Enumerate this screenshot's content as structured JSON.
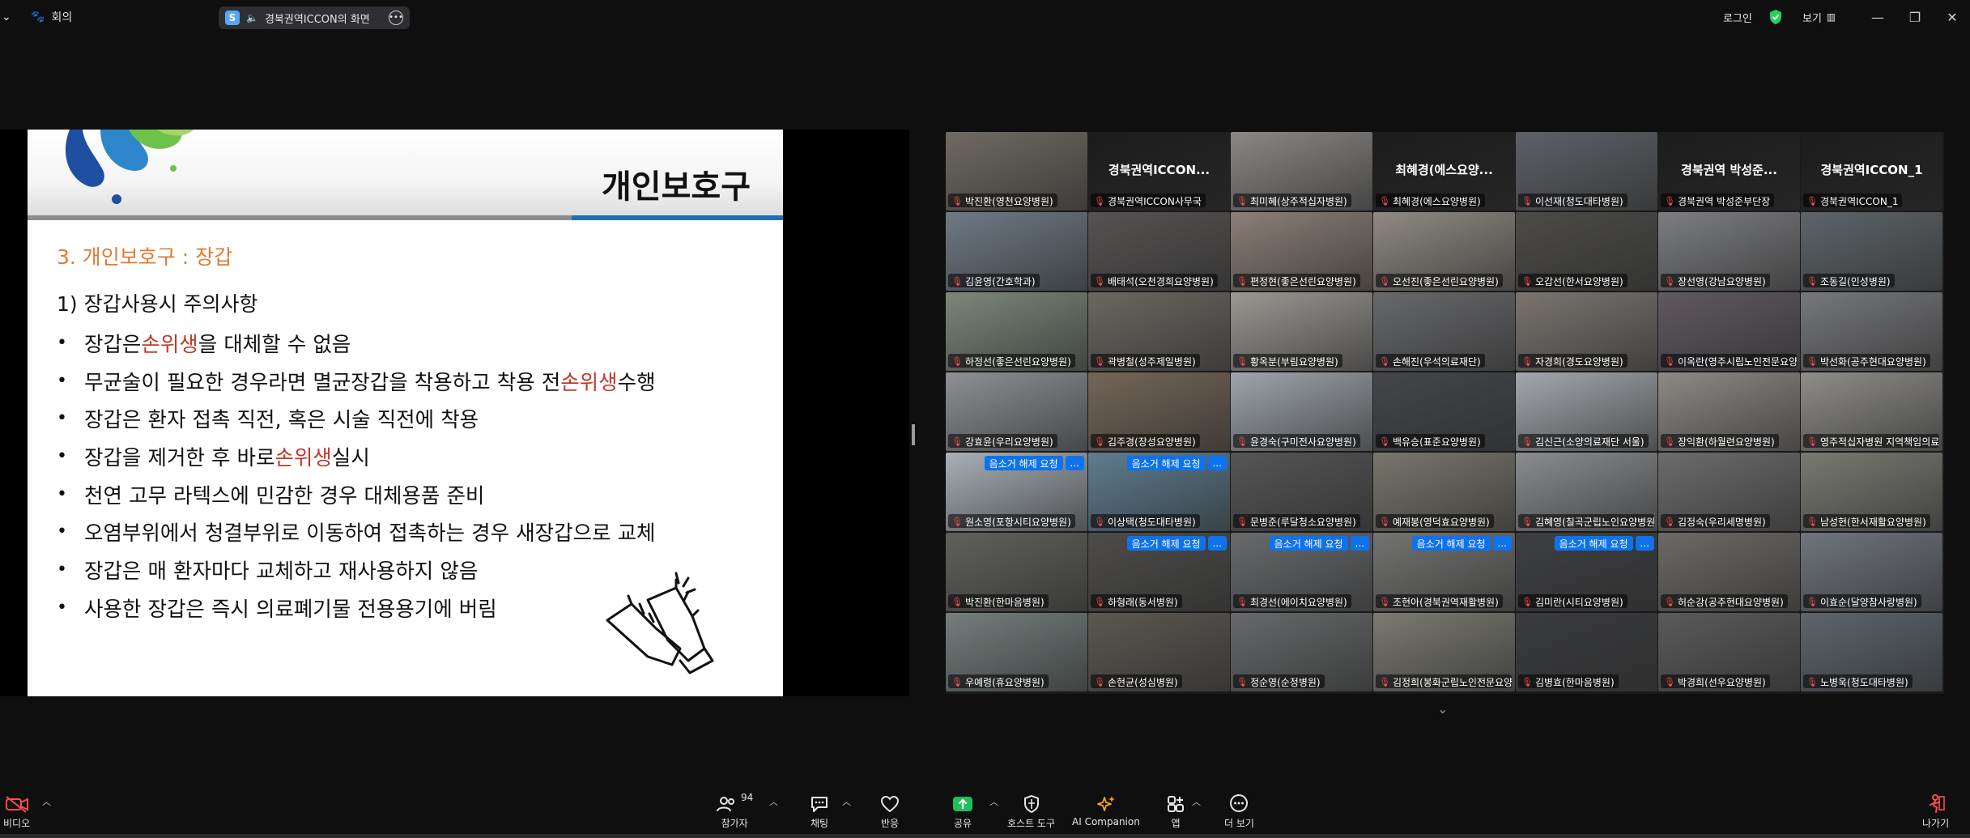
{
  "topbar": {
    "menu_label": "회의",
    "share_label": "경북권역ICCON의 화면",
    "login_label": "로그인",
    "view_label": "보기"
  },
  "slide": {
    "title": "개인보호구",
    "section": "3.   개인보호구 : 장갑",
    "subtitle": "1)   장갑사용시 주의사항",
    "bullets": [
      {
        "pre": "장갑은 ",
        "hl": "손위생",
        "post": "을 대체할 수 없음"
      },
      {
        "pre": "무균술이 필요한 경우라면 멸균장갑을 착용하고 착용 전 ",
        "hl": "손위생",
        "post": " 수행"
      },
      {
        "pre": "장갑은 환자 접촉 직전, 혹은 시술 직전에 착용",
        "hl": "",
        "post": ""
      },
      {
        "pre": "장갑을 제거한 후 바로 ",
        "hl": "손위생",
        "post": " 실시"
      },
      {
        "pre": "천연 고무 라텍스에 민감한 경우 대체용품 준비",
        "hl": "",
        "post": ""
      },
      {
        "pre": "오염부위에서 청결부위로 이동하여 접촉하는 경우 새장갑으로 교체",
        "hl": "",
        "post": ""
      },
      {
        "pre": "장갑은 매 환자마다 교체하고 재사용하지 않음",
        "hl": "",
        "post": ""
      },
      {
        "pre": "사용한 장갑은 즉시 의료폐기물 전용용기에 버림",
        "hl": "",
        "post": ""
      }
    ]
  },
  "gallery": {
    "unmute_request": "음소거 해제 요청",
    "more": "...",
    "tiles": [
      {
        "name": "박진환(영천요양병원)",
        "big": "",
        "bg": "#6f6a63",
        "req": false
      },
      {
        "name": "경북권역ICCON사무국",
        "big": "경북권역ICCON...",
        "bg": "#1c1c1c",
        "req": false
      },
      {
        "name": "최미혜(상주적십자병원)",
        "big": "",
        "bg": "#8a8886",
        "req": false
      },
      {
        "name": "최혜경(에스요양병원)",
        "big": "최혜경(에스요양...",
        "bg": "#1c1c1c",
        "req": false
      },
      {
        "name": "이선재(청도대타병원)",
        "big": "",
        "bg": "#5d6166",
        "req": false
      },
      {
        "name": "경북권역 박성준부단장",
        "big": "경북권역 박성준...",
        "bg": "#1c1c1c",
        "req": false
      },
      {
        "name": "경북권역ICCON_1",
        "big": "경북권역ICCON_1",
        "bg": "#1c1c1c",
        "req": false
      },
      {
        "name": "김윤영(간호학과)",
        "big": "",
        "bg": "#6f7a86",
        "req": false
      },
      {
        "name": "배태석(오천경희요양병원)",
        "big": "",
        "bg": "#555352",
        "req": false
      },
      {
        "name": "편정현(좋은선린요양병원)",
        "big": "",
        "bg": "#8c7f77",
        "req": false
      },
      {
        "name": "오선진(좋은선린요양병원)",
        "big": "",
        "bg": "#8f8a84",
        "req": false
      },
      {
        "name": "오갑선(한서요양병원)",
        "big": "",
        "bg": "#4c4b48",
        "req": false
      },
      {
        "name": "장선영(강남요양병원)",
        "big": "",
        "bg": "#7d7e80",
        "req": false
      },
      {
        "name": "조동길(인성병원)",
        "big": "",
        "bg": "#5e6468",
        "req": false
      },
      {
        "name": "하정선(좋은선린요양병원)",
        "big": "",
        "bg": "#7c877b",
        "req": false
      },
      {
        "name": "곽병철(성주제일병원)",
        "big": "",
        "bg": "#6b6762",
        "req": false
      },
      {
        "name": "황옥분(부림요양병원)",
        "big": "",
        "bg": "#9a9893",
        "req": false
      },
      {
        "name": "손해진(우석의료재단)",
        "big": "",
        "bg": "#68696b",
        "req": false
      },
      {
        "name": "자경희(경도요양병원)",
        "big": "",
        "bg": "#7a7571",
        "req": false
      },
      {
        "name": "이옥란(영주시립노인전문요양병원)",
        "big": "",
        "bg": "#5f5960",
        "req": false
      },
      {
        "name": "박선화(공주현대요양병원)",
        "big": "",
        "bg": "#77787a",
        "req": false
      },
      {
        "name": "강효윤(우리요양병원)",
        "big": "",
        "bg": "#8e9094",
        "req": false
      },
      {
        "name": "김주경(장성요양병원)",
        "big": "",
        "bg": "#746658",
        "req": false
      },
      {
        "name": "윤경숙(구미전사요양병원)",
        "big": "",
        "bg": "#9fa5ab",
        "req": false
      },
      {
        "name": "백유승(표준요양병원)",
        "big": "",
        "bg": "#44464a",
        "req": false
      },
      {
        "name": "김신근(소양의료재단 서울)",
        "big": "",
        "bg": "#a4a8ad",
        "req": false
      },
      {
        "name": "장익환(하월련요양병원)",
        "big": "",
        "bg": "#8d8a86",
        "req": false
      },
      {
        "name": "영주적십자병원 지역책임의료",
        "big": "",
        "bg": "#8e8d89",
        "req": false
      },
      {
        "name": "원소영(포항시티요양병원)",
        "big": "",
        "bg": "#a9b0b6",
        "req": true
      },
      {
        "name": "이상택(청도대타병원)",
        "big": "",
        "bg": "#5f7d8f",
        "req": true
      },
      {
        "name": "문병준(루달청소요양병원)",
        "big": "",
        "bg": "#555555",
        "req": false
      },
      {
        "name": "예재봉(영덕효요양병원)",
        "big": "",
        "bg": "#79766c",
        "req": false
      },
      {
        "name": "김혜영(칠곡군립노인요양병원)",
        "big": "",
        "bg": "#8a8c8f",
        "req": false
      },
      {
        "name": "김정숙(우리세명병원)",
        "big": "",
        "bg": "#6c6c6c",
        "req": false
      },
      {
        "name": "남성현(한서재활요양병원)",
        "big": "",
        "bg": "#7a7a74",
        "req": false
      },
      {
        "name": "박진환(한마음병원)",
        "big": "",
        "bg": "#60605c",
        "req": false
      },
      {
        "name": "하형래(동서병원)",
        "big": "",
        "bg": "#4d4c4a",
        "req": true
      },
      {
        "name": "최경선(에이치요양병원)",
        "big": "",
        "bg": "#686a6c",
        "req": true
      },
      {
        "name": "조현아(경북권역재활병원)",
        "big": "",
        "bg": "#747472",
        "req": true
      },
      {
        "name": "김미란(시티요양병원)",
        "big": "",
        "bg": "#3e3f41",
        "req": true
      },
      {
        "name": "허순강(공주현대요양병원)",
        "big": "",
        "bg": "#6c6a66",
        "req": false
      },
      {
        "name": "이효순(달양참사랑병원)",
        "big": "",
        "bg": "#70757d",
        "req": false
      },
      {
        "name": "우예령(휴요양병원)",
        "big": "",
        "bg": "#747f7d",
        "req": false
      },
      {
        "name": "손현균(성심병원)",
        "big": "",
        "bg": "#5b5752",
        "req": false
      },
      {
        "name": "정순영(순정병원)",
        "big": "",
        "bg": "#67696a",
        "req": false
      },
      {
        "name": "김정희(봉화군립노인전문요양병원)",
        "big": "",
        "bg": "#7b7a73",
        "req": false
      },
      {
        "name": "김병효(한마음병원)",
        "big": "",
        "bg": "#3a3b3d",
        "req": false
      },
      {
        "name": "박경희(선우요양병원)",
        "big": "",
        "bg": "#5a5a5a",
        "req": false
      },
      {
        "name": "노병욱(청도대타병원)",
        "big": "",
        "bg": "#5d656c",
        "req": false
      }
    ]
  },
  "toolbar": {
    "video": "비디오",
    "participants": "참가자",
    "participants_count": "94",
    "chat": "채팅",
    "reactions": "반응",
    "share": "공유",
    "host_tools": "호스트 도구",
    "ai_companion": "AI Companion",
    "apps": "앱",
    "more": "더 보기",
    "leave": "나가기"
  },
  "colors": {
    "accent_green": "#23d160",
    "share_green": "#1fbf5a",
    "unmute_blue": "#0e72ed",
    "slide_orange": "#e07a32",
    "slide_red": "#c0392b"
  }
}
